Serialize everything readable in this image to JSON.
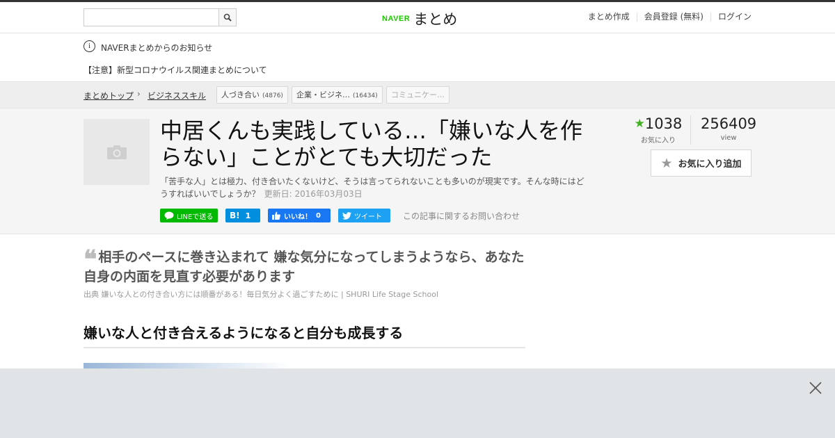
{
  "header": {
    "search": {
      "value": "",
      "placeholder": ""
    },
    "search_icon": "search-icon",
    "logo": {
      "naver": "NAVER",
      "matome": "まとめ"
    },
    "links": [
      "まとめ作成",
      "会員登録 (無料)",
      "ログイン"
    ],
    "brand_color": "#1ec800"
  },
  "notice": {
    "icon": "info-icon",
    "line1": "NAVERまとめからのお知らせ",
    "line2": "【注意】新型コロナウイルス関連まとめについて"
  },
  "breadcrumb": {
    "items": [
      "まとめトップ",
      "ビジネススキル"
    ],
    "tags": [
      {
        "label": "人づき合い",
        "count": "(4876)"
      },
      {
        "label": "企業・ビジネ…",
        "count": "(16434)"
      },
      {
        "label": "コミュニケー…",
        "count": ""
      }
    ]
  },
  "article": {
    "title": "中居くんも実践している…「嫌いな人を作らない」ことがとても大切だった",
    "description": "「苦手な人」とは極力、付き合いたくないけど、そうは言ってられないことも多いのが現実です。そんな時にはどうすればいいでしょうか？",
    "updated": "更新日: 2016年03月03日",
    "share": {
      "line": "LINEで送る",
      "hatena_label": "B!",
      "hatena_count": "1",
      "facebook_label": "いいね！",
      "facebook_count": "0",
      "twitter": "ツイート",
      "contact": "この記事に関するお問い合わせ"
    },
    "stats": {
      "favorites": "1038",
      "favorites_label": "お気に入り",
      "views": "256409",
      "views_label": "view"
    },
    "fav_button": "お気に入り追加"
  },
  "content": {
    "quote_mark": "❝",
    "quote": "相手のペースに巻き込まれて 嫌な気分になってしまうようなら、あなた自身の内面を見直す必要があります",
    "source": "出典 嫌いな人との付き合い方には順番がある！毎日気分よく過ごすために | SHURI Life Stage School",
    "heading": "嫌いな人と付き合えるようになると自分も成長する"
  },
  "overlay": {
    "close_icon": "close-icon"
  }
}
